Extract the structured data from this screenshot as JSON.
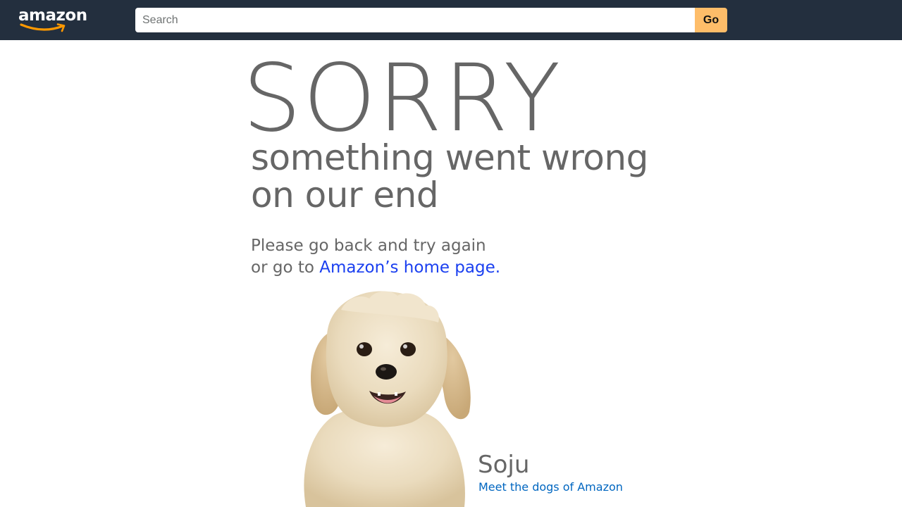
{
  "header": {
    "logo_text": "amazon",
    "search": {
      "placeholder": "Search",
      "value": ""
    },
    "go_label": "Go",
    "colors": {
      "bar": "#232f3e",
      "go_button": "#febd69",
      "logo_smile": "#ff9900"
    }
  },
  "error": {
    "headline": "SORRY",
    "subline_1": "something went wrong",
    "subline_2": "on our end",
    "instructions_line_1": "Please go back and try again",
    "instructions_line_2_prefix": "or go to ",
    "home_link": "Amazon’s home page."
  },
  "dog": {
    "image_icon": "dog-photo",
    "name": "Soju",
    "link": "Meet the dogs of Amazon"
  }
}
